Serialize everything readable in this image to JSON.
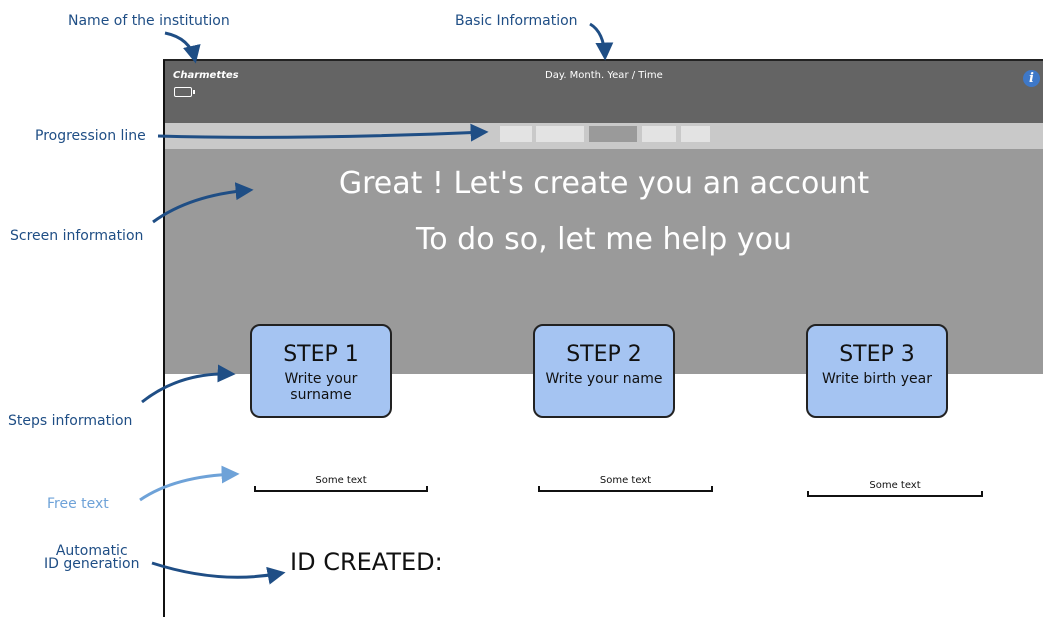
{
  "annotations": {
    "institution": "Name of the institution",
    "basic_info": "Basic Information",
    "progression": "Progression line",
    "screen_info": "Screen information",
    "steps_info": "Steps information",
    "free_text": "Free text",
    "id_gen_line1": "Automatic",
    "id_gen_line2": "ID generation"
  },
  "screen": {
    "institution_name": "Charmettes",
    "datetime": "Day. Month. Year / Time",
    "info_icon": "i",
    "hero_line1": "Great ! Let's create you an account",
    "hero_line2": "To do so, let me help you",
    "steps": [
      {
        "title": "STEP 1",
        "subtitle": "Write your surname"
      },
      {
        "title": "STEP 2",
        "subtitle": "Write your name"
      },
      {
        "title": "STEP 3",
        "subtitle": "Write birth year"
      }
    ],
    "free_texts": [
      "Some text",
      "Some text",
      "Some text"
    ],
    "id_created": "ID CREATED:"
  },
  "colors": {
    "annotation": "#1f4e85",
    "free_text_annotation": "#6ea2d8",
    "topbar": "#646464",
    "hero": "#9a9a9a",
    "step_fill": "#a5c4f2"
  }
}
